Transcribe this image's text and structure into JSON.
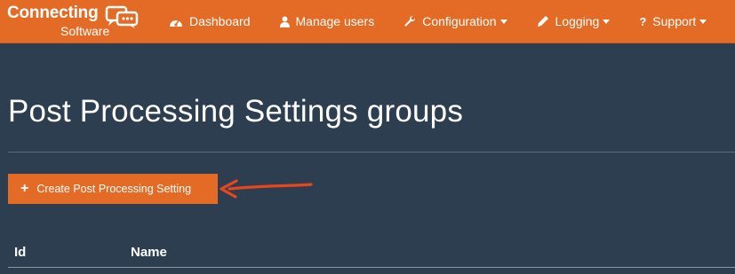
{
  "brand": {
    "line1": "Connecting",
    "line2": "Software"
  },
  "nav": [
    {
      "label": "Dashboard",
      "icon": "dashboard-icon",
      "dropdown": false
    },
    {
      "label": "Manage users",
      "icon": "user-icon",
      "dropdown": false
    },
    {
      "label": "Configuration",
      "icon": "wrench-icon",
      "dropdown": true
    },
    {
      "label": "Logging",
      "icon": "pencil-icon",
      "dropdown": true
    },
    {
      "label": "Support",
      "icon": "question-icon",
      "dropdown": true
    }
  ],
  "page": {
    "title": "Post Processing Settings groups"
  },
  "create_button": {
    "label": "Create Post Processing Setting"
  },
  "table": {
    "headers": [
      "Id",
      "Name"
    ]
  },
  "colors": {
    "accent": "#e36b25",
    "background": "#2c3e50",
    "annotation_arrow": "#e8471c"
  }
}
